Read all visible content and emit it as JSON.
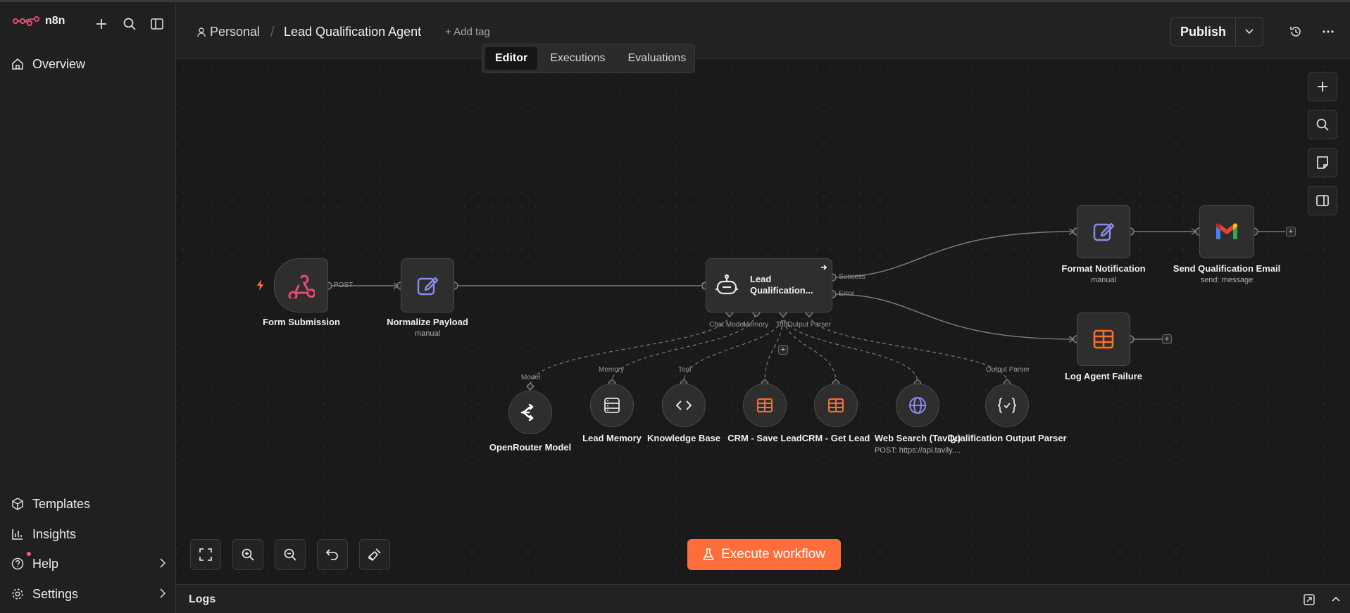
{
  "app": {
    "name": "n8n"
  },
  "sidebar": {
    "overview": "Overview",
    "templates": "Templates",
    "insights": "Insights",
    "help": "Help",
    "settings": "Settings"
  },
  "header": {
    "project": "Personal",
    "workflow_title": "Lead Qualification Agent",
    "add_tag": "+ Add tag",
    "publish": "Publish"
  },
  "tabs": [
    "Editor",
    "Executions",
    "Evaluations"
  ],
  "active_tab": "Editor",
  "nodes": {
    "form_submission": {
      "label": "Form Submission",
      "port": "POST"
    },
    "normalize": {
      "label": "Normalize Payload",
      "sub": "manual"
    },
    "agent": {
      "label": "Lead Qualification...",
      "success": "Success",
      "error": "Error",
      "ports": [
        "Chat Model",
        "Memory",
        "Tool",
        "Output Parser"
      ]
    },
    "format_notification": {
      "label": "Format Notification",
      "sub": "manual"
    },
    "send_email": {
      "label": "Send Qualification Email",
      "sub": "send: message"
    },
    "log_failure": {
      "label": "Log Agent Failure"
    },
    "openrouter": {
      "label": "OpenRouter Model",
      "port": "Model"
    },
    "lead_memory": {
      "label": "Lead Memory",
      "port": "Memory"
    },
    "knowledge_base": {
      "label": "Knowledge Base",
      "port": "Tool"
    },
    "crm_save": {
      "label": "CRM - Save Lead"
    },
    "crm_get": {
      "label": "CRM - Get Lead"
    },
    "web_search": {
      "label": "Web Search (Tavily)",
      "sub": "POST: https://api.tavily...."
    },
    "output_parser": {
      "label": "Qualification Output Parser",
      "port": "Output Parser"
    }
  },
  "execute_button": "Execute workflow",
  "logs": {
    "label": "Logs"
  },
  "colors": {
    "accent": "#ff6d3b",
    "brand": "#ea4b71",
    "sheets": "#ff6d2d",
    "purple": "#8b8cf0"
  }
}
